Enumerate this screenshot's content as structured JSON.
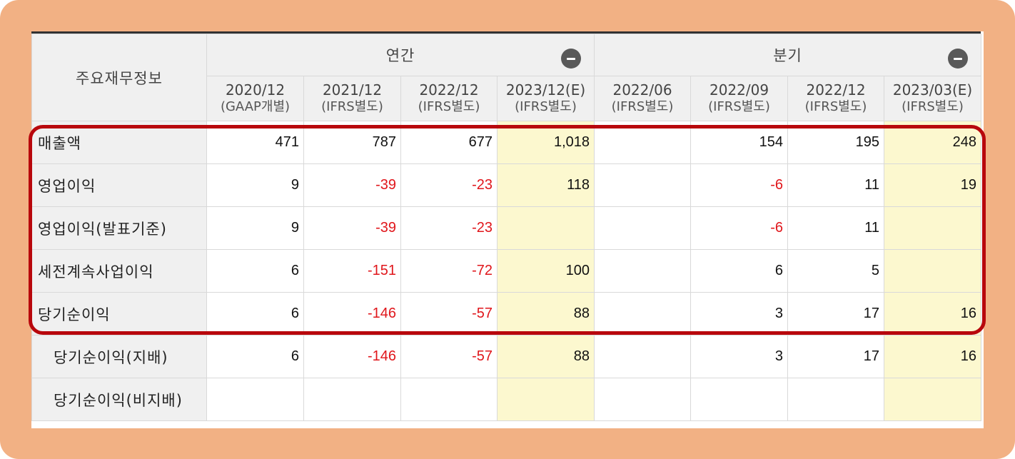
{
  "table": {
    "corner_label": "주요재무정보",
    "groups": [
      {
        "label": "연간",
        "toggle_icon": "minus-circle-icon"
      },
      {
        "label": "분기",
        "toggle_icon": "minus-circle-icon"
      }
    ],
    "periods": [
      {
        "date": "2020/12",
        "basis": "(GAAP개별)"
      },
      {
        "date": "2021/12",
        "basis": "(IFRS별도)"
      },
      {
        "date": "2022/12",
        "basis": "(IFRS별도)"
      },
      {
        "date": "2023/12(E)",
        "basis": "(IFRS별도)"
      },
      {
        "date": "2022/06",
        "basis": "(IFRS별도)"
      },
      {
        "date": "2022/09",
        "basis": "(IFRS별도)"
      },
      {
        "date": "2022/12",
        "basis": "(IFRS별도)"
      },
      {
        "date": "2023/03(E)",
        "basis": "(IFRS별도)"
      }
    ],
    "rows": [
      {
        "label": "매출액",
        "values": [
          "471",
          "787",
          "677",
          "1,018",
          "",
          "154",
          "195",
          "248"
        ]
      },
      {
        "label": "영업이익",
        "values": [
          "9",
          "-39",
          "-23",
          "118",
          "",
          "-6",
          "11",
          "19"
        ]
      },
      {
        "label": "영업이익(발표기준)",
        "values": [
          "9",
          "-39",
          "-23",
          "",
          "",
          "-6",
          "11",
          ""
        ]
      },
      {
        "label": "세전계속사업이익",
        "values": [
          "6",
          "-151",
          "-72",
          "100",
          "",
          "6",
          "5",
          ""
        ]
      },
      {
        "label": "당기순이익",
        "values": [
          "6",
          "-146",
          "-57",
          "88",
          "",
          "3",
          "17",
          "16"
        ]
      },
      {
        "label": "당기순이익(지배)",
        "values": [
          "6",
          "-146",
          "-57",
          "88",
          "",
          "3",
          "17",
          "16"
        ]
      },
      {
        "label": "당기순이익(비지배)",
        "values": [
          "",
          "",
          "",
          "",
          "",
          "",
          "",
          ""
        ]
      }
    ]
  },
  "colors": {
    "frame_background": "#F2B184",
    "highlight_border": "#B8070C",
    "negative_value": "#E0161B",
    "estimate_cell": "#FCF8CF",
    "header_background": "#F0F0F0"
  }
}
